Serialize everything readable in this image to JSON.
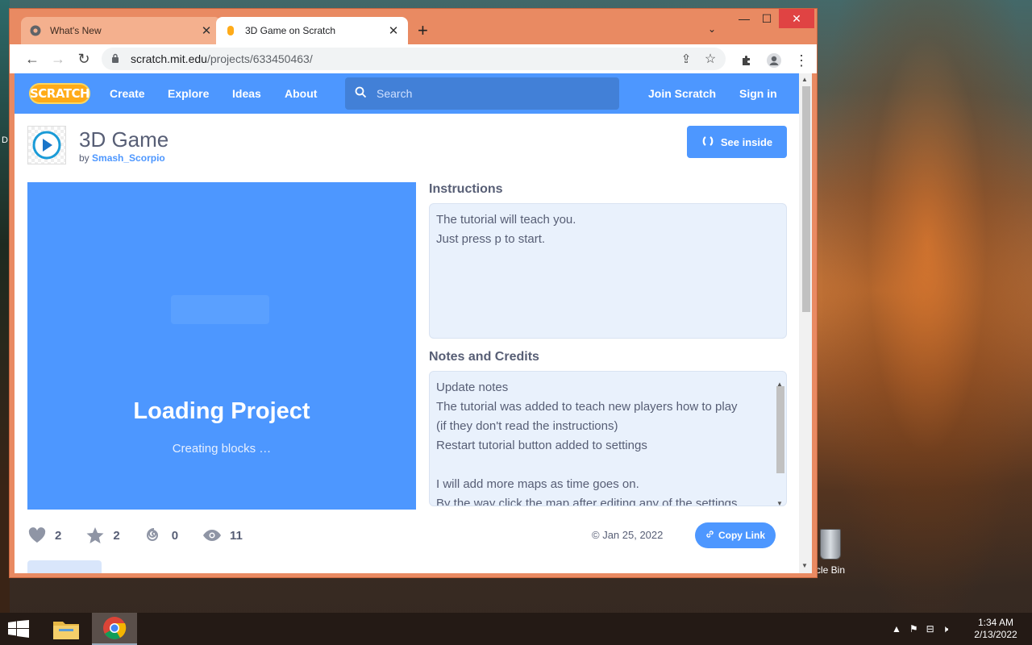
{
  "browser": {
    "tabs": [
      {
        "title": "What's New",
        "active": false
      },
      {
        "title": "3D Game on Scratch",
        "active": true
      }
    ],
    "new_tab_label": "+",
    "url_host": "scratch.mit.edu",
    "url_path": "/projects/633450463/"
  },
  "scratch_nav": {
    "logo": "SCRATCH",
    "links": [
      "Create",
      "Explore",
      "Ideas",
      "About"
    ],
    "search_placeholder": "Search",
    "join": "Join Scratch",
    "signin": "Sign in"
  },
  "project": {
    "title": "3D Game",
    "by": "by",
    "author": "Smash_Scorpio",
    "see_inside": "See inside",
    "stage": {
      "loading": "Loading Project",
      "status": "Creating blocks …"
    },
    "instructions_heading": "Instructions",
    "instructions": [
      "The tutorial will teach you.",
      "Just press p to start."
    ],
    "notes_heading": "Notes and Credits",
    "notes": [
      "Update notes",
      "The tutorial was added to teach new players how to play",
      "(if they don't read the instructions)",
      "Restart tutorial button added to settings",
      "",
      "I will add more maps as time goes on.",
      "By the way click the map after editing any of the settings"
    ],
    "stats": {
      "loves": "2",
      "favorites": "2",
      "remixes": "0",
      "views": "11"
    },
    "date": "© Jan 25, 2022",
    "copy_link": "Copy Link"
  },
  "desktop": {
    "recycle_bin_label": "cle Bin",
    "left_edge_label": "D"
  },
  "taskbar": {
    "time": "1:34 AM",
    "date": "2/13/2022"
  },
  "colors": {
    "scratch_blue": "#4d97ff",
    "scratch_text": "#575e75",
    "scratch_orange": "#ffab19",
    "window_frame": "#e98a62"
  }
}
